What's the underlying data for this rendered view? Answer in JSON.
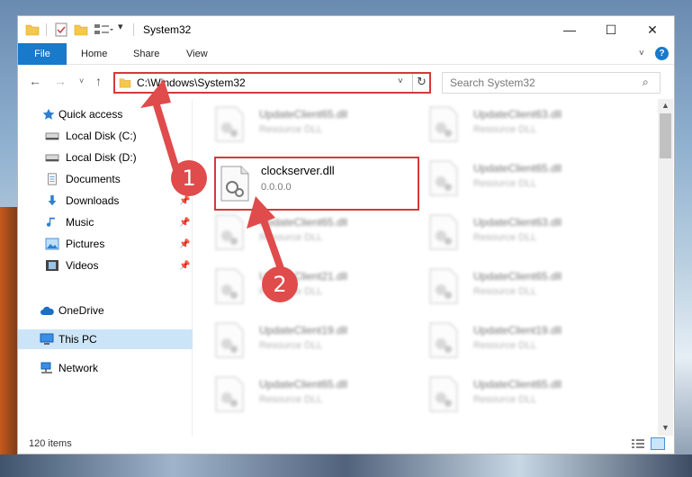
{
  "window": {
    "title": "System32"
  },
  "quick_access_toolbar": {
    "dropdown": "▾"
  },
  "window_controls": {
    "minimize": "—",
    "maximize": "☐",
    "close": "✕"
  },
  "ribbon": {
    "tabs": [
      "File",
      "Home",
      "Share",
      "View"
    ],
    "expand": "˅",
    "help": "?"
  },
  "navigation": {
    "back": "←",
    "forward": "→",
    "recent": "˅",
    "up": "↑",
    "address": "C:\\Windows\\System32",
    "address_dropdown": "˅",
    "refresh": "↻",
    "search_placeholder": "Search System32",
    "search_icon": "⌕"
  },
  "sidebar": {
    "items": [
      {
        "label": "Quick access",
        "icon": "star-icon",
        "pin": ""
      },
      {
        "label": "Local Disk (C:)",
        "icon": "drive-icon",
        "pin": ""
      },
      {
        "label": "Local Disk (D:)",
        "icon": "drive-icon",
        "pin": ""
      },
      {
        "label": "Documents",
        "icon": "documents-icon",
        "pin": ""
      },
      {
        "label": "Downloads",
        "icon": "download-icon",
        "pin": "📌"
      },
      {
        "label": "Music",
        "icon": "music-icon",
        "pin": "📌"
      },
      {
        "label": "Pictures",
        "icon": "pictures-icon",
        "pin": "📌"
      },
      {
        "label": "Videos",
        "icon": "videos-icon",
        "pin": "📌"
      },
      {
        "label": "OneDrive",
        "icon": "cloud-icon",
        "pin": ""
      },
      {
        "label": "This PC",
        "icon": "computer-icon",
        "pin": ""
      },
      {
        "label": "Network",
        "icon": "network-icon",
        "pin": ""
      }
    ],
    "selected": "This PC"
  },
  "files": {
    "highlighted": {
      "name": "clockserver.dll",
      "type": "0.0.0.0"
    },
    "blurred": [
      {
        "name": "UpdateClient65.dll",
        "type": "Resource DLL"
      },
      {
        "name": "UpdateClient63.dll",
        "type": "Resource DLL"
      },
      {
        "name": "UpdateClient65.dll",
        "type": "Resource DLL"
      },
      {
        "name": "UpdateClient65.dll",
        "type": "Resource DLL"
      },
      {
        "name": "UpdateClient63.dll",
        "type": "Resource DLL"
      },
      {
        "name": "UpdateClient21.dll",
        "type": "Resource DLL"
      },
      {
        "name": "UpdateClient65.dll",
        "type": "Resource DLL"
      },
      {
        "name": "UpdateClient19.dll",
        "type": "Resource DLL"
      },
      {
        "name": "UpdateClient19.dll",
        "type": "Resource DLL"
      },
      {
        "name": "UpdateClient65.dll",
        "type": "Resource DLL"
      },
      {
        "name": "UpdateClient65.dll",
        "type": "Resource DLL"
      }
    ]
  },
  "status": {
    "item_count": "120 items"
  },
  "annotations": {
    "step1": "1",
    "step2": "2"
  },
  "colors": {
    "accent": "#1979ca",
    "highlight": "#d33a3a",
    "badge": "#e04b4b",
    "selected_bg": "#cce4f7"
  }
}
